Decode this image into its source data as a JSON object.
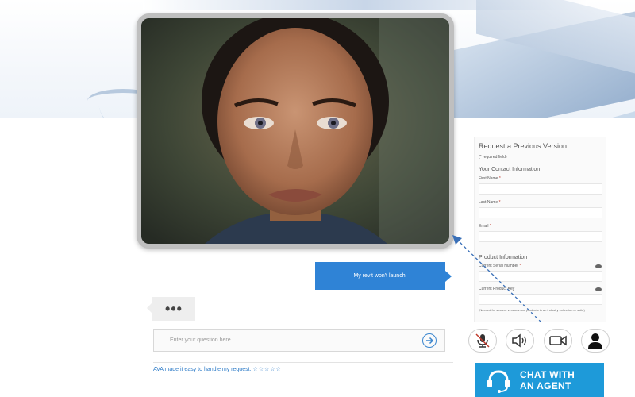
{
  "form": {
    "title": "Request a Previous Version",
    "required_note": "(* required field)",
    "contact_section": "Your Contact Information",
    "first_name_label": "First Name",
    "last_name_label": "Last Name",
    "email_label": "Email",
    "product_section": "Product Information",
    "serial_label": "Current Serial Number",
    "product_key_label": "Current Product Key",
    "note": "(Needed for student versions and products in an industry collection or suite)",
    "required_mark": "*"
  },
  "chat": {
    "user_message": "My revit won't launch.",
    "typing_indicator": "•••",
    "input_placeholder": "Enter your question here...",
    "rating_text": "AVA made it easy to handle my request:",
    "rating_stars": "☆☆☆☆☆"
  },
  "agent_button": {
    "line1": "CHAT WITH",
    "line2": "AN AGENT"
  },
  "media_buttons": [
    "microphone-icon",
    "speaker-icon",
    "video-camera-icon",
    "user-profile-icon"
  ],
  "colors": {
    "accent_blue": "#2f83d6",
    "agent_button": "#1e9ad9",
    "link_blue": "#2e7cc8"
  }
}
